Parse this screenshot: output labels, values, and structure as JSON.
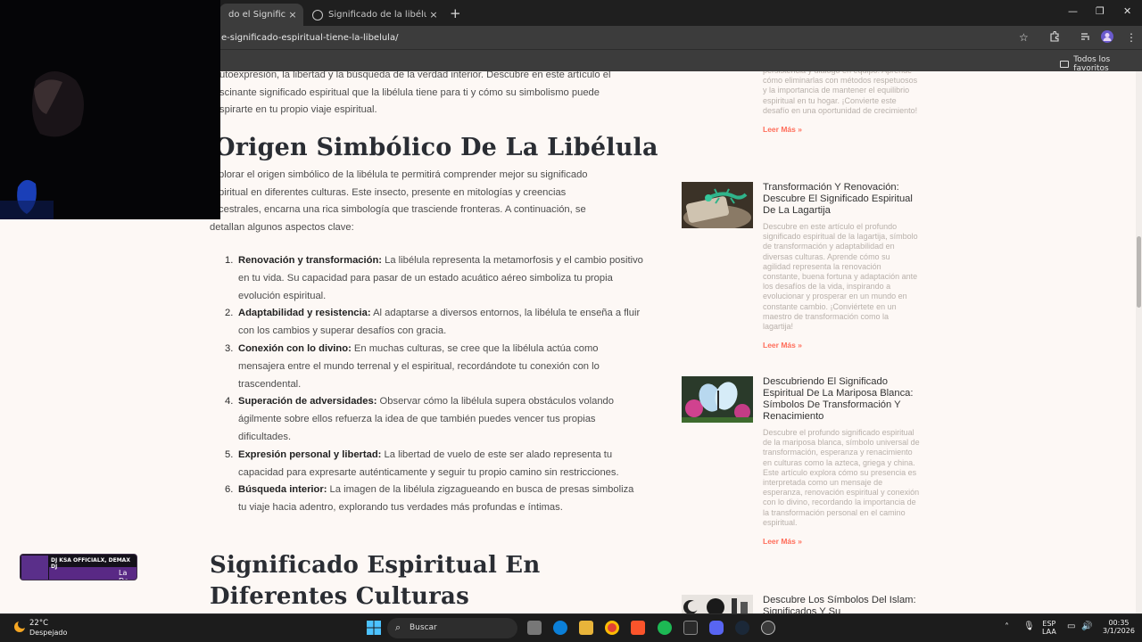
{
  "browser": {
    "tabs": [
      {
        "label": "do el Significado Es",
        "active": true
      },
      {
        "label": "Significado de la libélula: ¿Qué",
        "active": false
      }
    ],
    "url": "e-significado-espiritual-tiene-la-libelula/",
    "bookmarks_label": "Todos los favoritos",
    "new_tab_symbol": "+",
    "close_symbol": "×",
    "minimize_symbol": "—",
    "restore_symbol": "❐",
    "window_close_symbol": "✕"
  },
  "article": {
    "intro_lines": [
      "utoexpresión, la libertad y la búsqueda de la verdad interior. Descubre en este artículo el",
      "scinante significado espiritual que la libélula tiene para ti y cómo su simbolismo puede",
      "spirarte en tu propio viaje espiritual."
    ],
    "heading_origen": "Origen Simbólico De La Libélula",
    "origen_lines": [
      "plorar el origen simbólico de la libélula te permitirá comprender mejor su significado",
      "piritual en diferentes culturas. Este insecto, presente en mitologías y creencias",
      "cestrales, encarna una rica simbología que trasciende fronteras. A continuación, se",
      "detallan algunos aspectos clave:"
    ],
    "aspects": [
      {
        "num": "1.",
        "title": "Renovación y transformación:",
        "text": " La libélula representa la metamorfosis y el cambio positivo en tu vida. Su capacidad para pasar de un estado acuático aéreo simboliza tu propia evolución espiritual."
      },
      {
        "num": "2.",
        "title": "Adaptabilidad y resistencia:",
        "text": " Al adaptarse a diversos entornos, la libélula te enseña a fluir con los cambios y superar desafíos con gracia."
      },
      {
        "num": "3.",
        "title": "Conexión con lo divino:",
        "text": " En muchas culturas, se cree que la libélula actúa como mensajera entre el mundo terrenal y el espiritual, recordándote tu conexión con lo trascendental."
      },
      {
        "num": "4.",
        "title": "Superación de adversidades:",
        "text": " Observar cómo la libélula supera obstáculos volando ágilmente sobre ellos refuerza la idea de que también puedes vencer tus propias dificultades."
      },
      {
        "num": "5.",
        "title": "Expresión personal y libertad:",
        "text": " La libertad de vuelo de este ser alado representa tu capacidad para expresarte auténticamente y seguir tu propio camino sin restricciones."
      },
      {
        "num": "6.",
        "title": "Búsqueda interior:",
        "text": " La imagen de la libélula zigzagueando en busca de presas simboliza tu viaje hacia adentro, explorando tus verdades más profundas e íntimas."
      }
    ],
    "heading_signif": "Significado Espiritual En Diferentes Culturas"
  },
  "sidebar": {
    "top_excerpt": "persistencia y diálogo en equipo. Aprende cómo eliminarlas con métodos respetuosos y la importancia de mantener el equilibrio espiritual en tu hogar. ¡Convierte este desafío en una oportunidad de crecimiento!",
    "read_more": "Leer Más »",
    "posts": [
      {
        "title": "Transformación Y Renovación: Descubre El Significado Espiritual De La Lagartija",
        "excerpt": "Descubre en este artículo el profundo significado espiritual de la lagartija, símbolo de transformación y adaptabilidad en diversas culturas. Aprende cómo su agilidad representa la renovación constante, buena fortuna y adaptación ante los desafíos de la vida, inspirando a evolucionar y prosperar en un mundo en constante cambio. ¡Conviértete en un maestro de transformación como la lagartija!"
      },
      {
        "title": "Descubriendo El Significado Espiritual De La Mariposa Blanca: Símbolos De Transformación Y Renacimiento",
        "excerpt": "Descubre el profundo significado espiritual de la mariposa blanca, símbolo universal de transformación, esperanza y renacimiento en culturas como la azteca, griega y china. Este artículo explora cómo su presencia es interpretada como un mensaje de esperanza, renovación espiritual y conexión con lo divino, recordando la importancia de la transformación personal en el camino espiritual."
      },
      {
        "title": "Descubre Los Símbolos Del Islam: Significados Y Su",
        "excerpt": ""
      }
    ]
  },
  "overlay": {
    "stream_banner": "DJ KSA OFFICIALX, DEMAX DJ",
    "stream_banner_sub": "La De"
  },
  "taskbar": {
    "weather_temp": "22°C",
    "weather_desc": "Despejado",
    "search_label": "Buscar",
    "lang_line1": "ESP",
    "lang_line2": "LAA",
    "time": "00:35",
    "date": "3/1/2026"
  },
  "colors": {
    "page_bg": "#fdf8f5",
    "read_more": "#ff6d5a",
    "heading": "#2a2d33"
  }
}
